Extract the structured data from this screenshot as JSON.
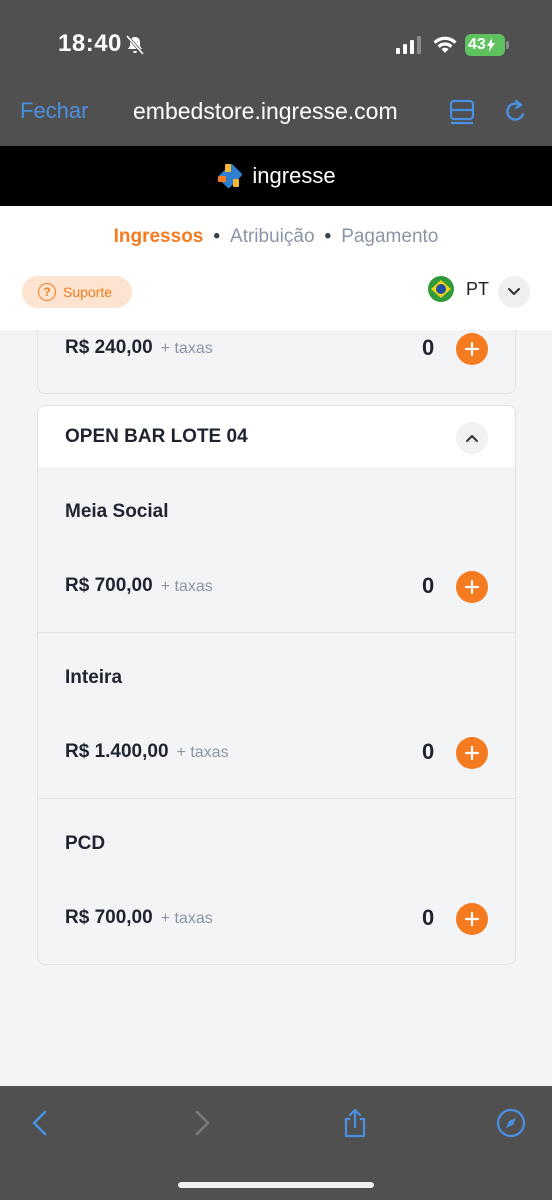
{
  "status_bar": {
    "time": "18:40",
    "battery": "43"
  },
  "browser": {
    "close_label": "Fechar",
    "url": "embedstore.ingresse.com"
  },
  "brand": {
    "name": "ingresse"
  },
  "steps": {
    "items": [
      "Ingressos",
      "Atribuição",
      "Pagamento"
    ],
    "separator": "•"
  },
  "support": {
    "label": "Suporte",
    "icon_glyph": "?"
  },
  "language": {
    "code": "PT"
  },
  "previous_card": {
    "price": "R$ 240,00",
    "fees": "+ taxas",
    "quantity": "0"
  },
  "batch": {
    "title": "OPEN BAR LOTE 04",
    "tickets": [
      {
        "name": "Meia Social",
        "price": "R$ 700,00",
        "fees": "+ taxas",
        "quantity": "0"
      },
      {
        "name": "Inteira",
        "price": "R$ 1.400,00",
        "fees": "+ taxas",
        "quantity": "0"
      },
      {
        "name": "PCD",
        "price": "R$ 700,00",
        "fees": "+ taxas",
        "quantity": "0"
      }
    ]
  },
  "colors": {
    "accent": "#f47b1f",
    "link": "#4a90e2",
    "chrome": "#505050",
    "text": "#1f2430",
    "muted": "#8b95a5"
  }
}
